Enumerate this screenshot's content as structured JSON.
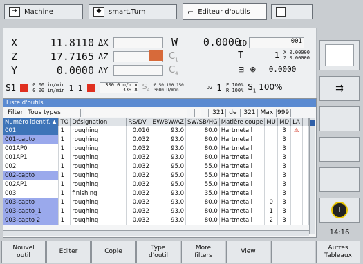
{
  "tabs": [
    {
      "label": "Machine",
      "icon": "arrow-right-icon"
    },
    {
      "label": "smart.Turn",
      "icon": "diamond-arrow-icon"
    },
    {
      "label": "Editeur d'outils",
      "icon": "tool-holder-icon"
    },
    {
      "label": "",
      "icon": "save-icon"
    }
  ],
  "position": {
    "x": {
      "axis": "X",
      "sup": "⊕",
      "value": "11.8110",
      "delta": "ΔX"
    },
    "z": {
      "axis": "Z",
      "value": "17.7165",
      "delta": "ΔZ"
    },
    "y": {
      "axis": "Y",
      "value": "0.0000",
      "delta": "ΔY"
    },
    "w": {
      "axis": "W",
      "value": "0.0000"
    },
    "c1": "C",
    "c1_sub": "1",
    "c4": "C",
    "c4_sub": "4",
    "id_label": "ID",
    "id_value": "001",
    "t_label": "T",
    "t_value": "1",
    "t_x": "0.00000",
    "t_z": "0.00000",
    "t_x_label": "X",
    "t_z_label": "Z",
    "spindle_value": "0.0000"
  },
  "status": {
    "s1_label": "S",
    "s1_sub": "1",
    "s1_sup": "S1",
    "feed1": "0.00 in/min",
    "feed2": "0.00 in/min",
    "spindle_num": "1",
    "spindle_num2": "1",
    "vel1": "300.0 m/min",
    "vel2": "339.8",
    "s4": "S",
    "s4_sub": "4",
    "feed_d": "0  50  100  150",
    "feed_d2": "3000 U/min",
    "override_label": "02",
    "override_num": "1",
    "f_label": "F",
    "f_val": "100%",
    "r_label": "R",
    "r_val": "100%",
    "s_label": "S",
    "s_sub": "1",
    "s_val": "100%"
  },
  "list": {
    "title": "Liste d'outils",
    "filter_label": "Filter",
    "filter_value": "Tous types",
    "count": "321",
    "of_label": "de",
    "of_value": "321",
    "max_label": "Max",
    "max_value": "999",
    "columns": [
      "Numéro identif. ▲",
      "TO",
      "Désignation",
      "RS/DV",
      "EW/BW/AZ",
      "SW/SB/HG",
      "Matière coupe",
      "MU",
      "MD",
      "LA",
      ""
    ],
    "rows": [
      {
        "id": "001",
        "to": "1",
        "des": "roughing",
        "rs": "0.016",
        "ew": "93.0",
        "sw": "80.0",
        "mat": "Hartmetall",
        "mu": "",
        "md": "3",
        "la": "⚠",
        "hl": false,
        "sel": true
      },
      {
        "id": "001-capto",
        "to": "1",
        "des": "roughing",
        "rs": "0.032",
        "ew": "93.0",
        "sw": "80.0",
        "mat": "Hartmetall",
        "mu": "",
        "md": "3",
        "la": "",
        "hl": true,
        "sel": false
      },
      {
        "id": "001AP0",
        "to": "1",
        "des": "roughing",
        "rs": "0.032",
        "ew": "93.0",
        "sw": "80.0",
        "mat": "Hartmetall",
        "mu": "",
        "md": "3",
        "la": "",
        "hl": false,
        "sel": false
      },
      {
        "id": "001AP1",
        "to": "1",
        "des": "roughing",
        "rs": "0.032",
        "ew": "93.0",
        "sw": "80.0",
        "mat": "Hartmetall",
        "mu": "",
        "md": "3",
        "la": "",
        "hl": false,
        "sel": false
      },
      {
        "id": "002",
        "to": "1",
        "des": "roughing",
        "rs": "0.032",
        "ew": "95.0",
        "sw": "55.0",
        "mat": "Hartmetall",
        "mu": "",
        "md": "3",
        "la": "",
        "hl": false,
        "sel": false
      },
      {
        "id": "002-capto",
        "to": "1",
        "des": "roughing",
        "rs": "0.032",
        "ew": "95.0",
        "sw": "55.0",
        "mat": "Hartmetall",
        "mu": "",
        "md": "3",
        "la": "",
        "hl": true,
        "sel": false
      },
      {
        "id": "002AP1",
        "to": "1",
        "des": "roughing",
        "rs": "0.032",
        "ew": "95.0",
        "sw": "55.0",
        "mat": "Hartmetall",
        "mu": "",
        "md": "3",
        "la": "",
        "hl": false,
        "sel": false
      },
      {
        "id": "003",
        "to": "1",
        "des": "finishing",
        "rs": "0.032",
        "ew": "93.0",
        "sw": "35.0",
        "mat": "Hartmetall",
        "mu": "",
        "md": "3",
        "la": "",
        "hl": false,
        "sel": false
      },
      {
        "id": "003-capto",
        "to": "1",
        "des": "roughing",
        "rs": "0.032",
        "ew": "93.0",
        "sw": "80.0",
        "mat": "Hartmetall",
        "mu": "0",
        "md": "3",
        "la": "",
        "hl": true,
        "sel": false
      },
      {
        "id": "003-capto_1",
        "to": "1",
        "des": "roughing",
        "rs": "0.032",
        "ew": "93.0",
        "sw": "80.0",
        "mat": "Hartmetall",
        "mu": "1",
        "md": "3",
        "la": "",
        "hl": true,
        "sel": false
      },
      {
        "id": "003-capto 2",
        "to": "1",
        "des": "roughing",
        "rs": "0.032",
        "ew": "93.0",
        "sw": "80.0",
        "mat": "Hartmetall",
        "mu": "2",
        "md": "3",
        "la": "",
        "hl": true,
        "sel": false
      }
    ]
  },
  "clock": "14:16",
  "softkeys": [
    "Nouvel\noutil",
    "Editer",
    "Copie",
    "Type\nd'outil",
    "More\nfilters",
    "View",
    "",
    "Autres\nTableaux"
  ]
}
